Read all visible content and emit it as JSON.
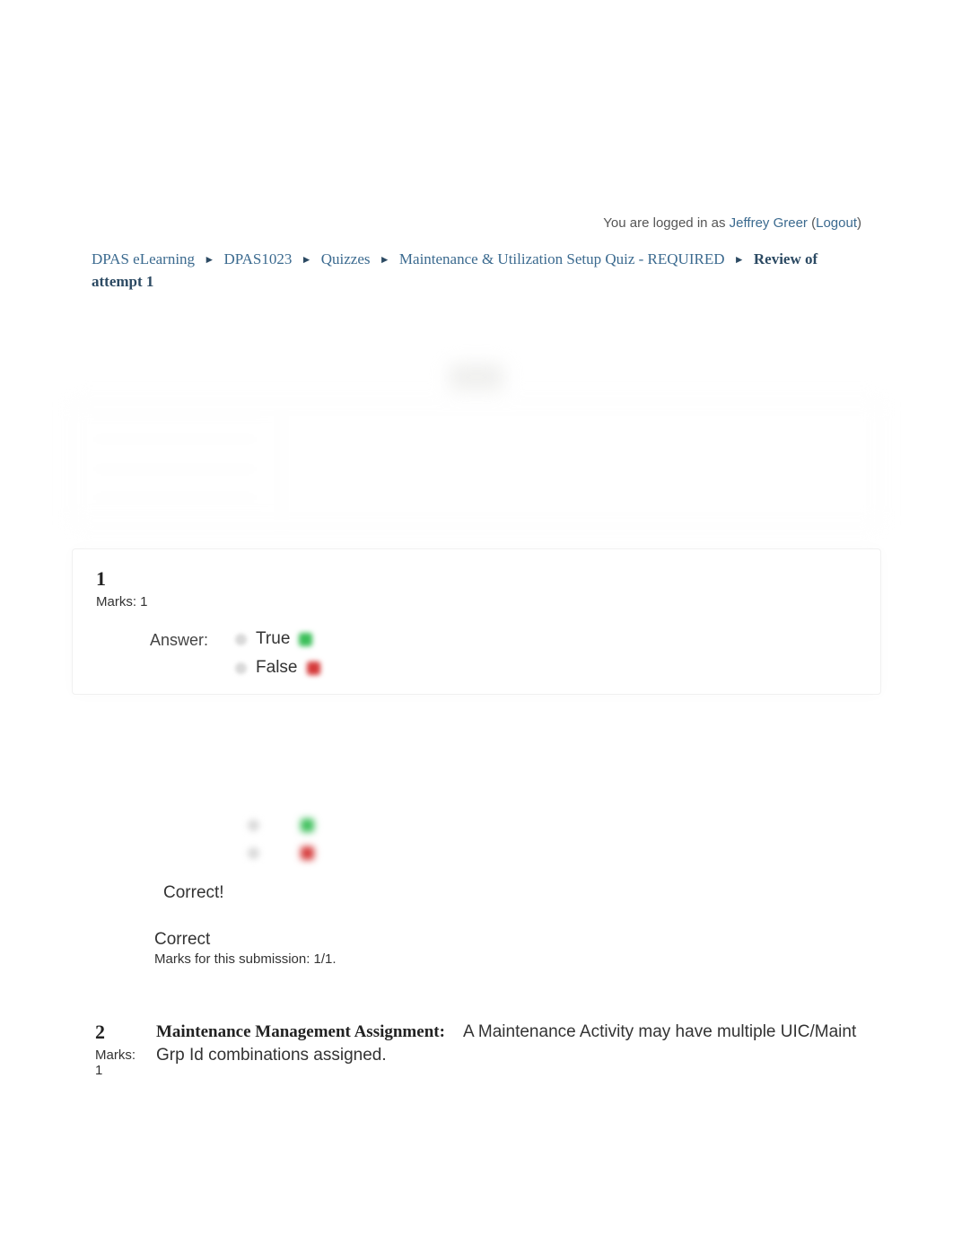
{
  "header": {
    "logged_in_prefix": "You are logged in as ",
    "user_name": "Jeffrey Greer",
    "logout_label": "Logout"
  },
  "breadcrumb": {
    "items": [
      "DPAS eLearning",
      "DPAS1023",
      "Quizzes",
      "Maintenance & Utilization Setup Quiz - REQUIRED"
    ],
    "current": "Review of attempt 1"
  },
  "questions": [
    {
      "number": "1",
      "marks_label": "Marks: 1",
      "answer_label": "Answer:",
      "choices": [
        "True",
        "False"
      ],
      "feedback_text": "Correct!",
      "status_text": "Correct",
      "submission_marks": "Marks for this submission: 1/1."
    },
    {
      "number": "2",
      "marks_label": "Marks: 1",
      "title": "Maintenance Management Assignment:",
      "body": "A Maintenance Activity may have multiple UIC/Maint Grp Id combinations assigned."
    }
  ]
}
